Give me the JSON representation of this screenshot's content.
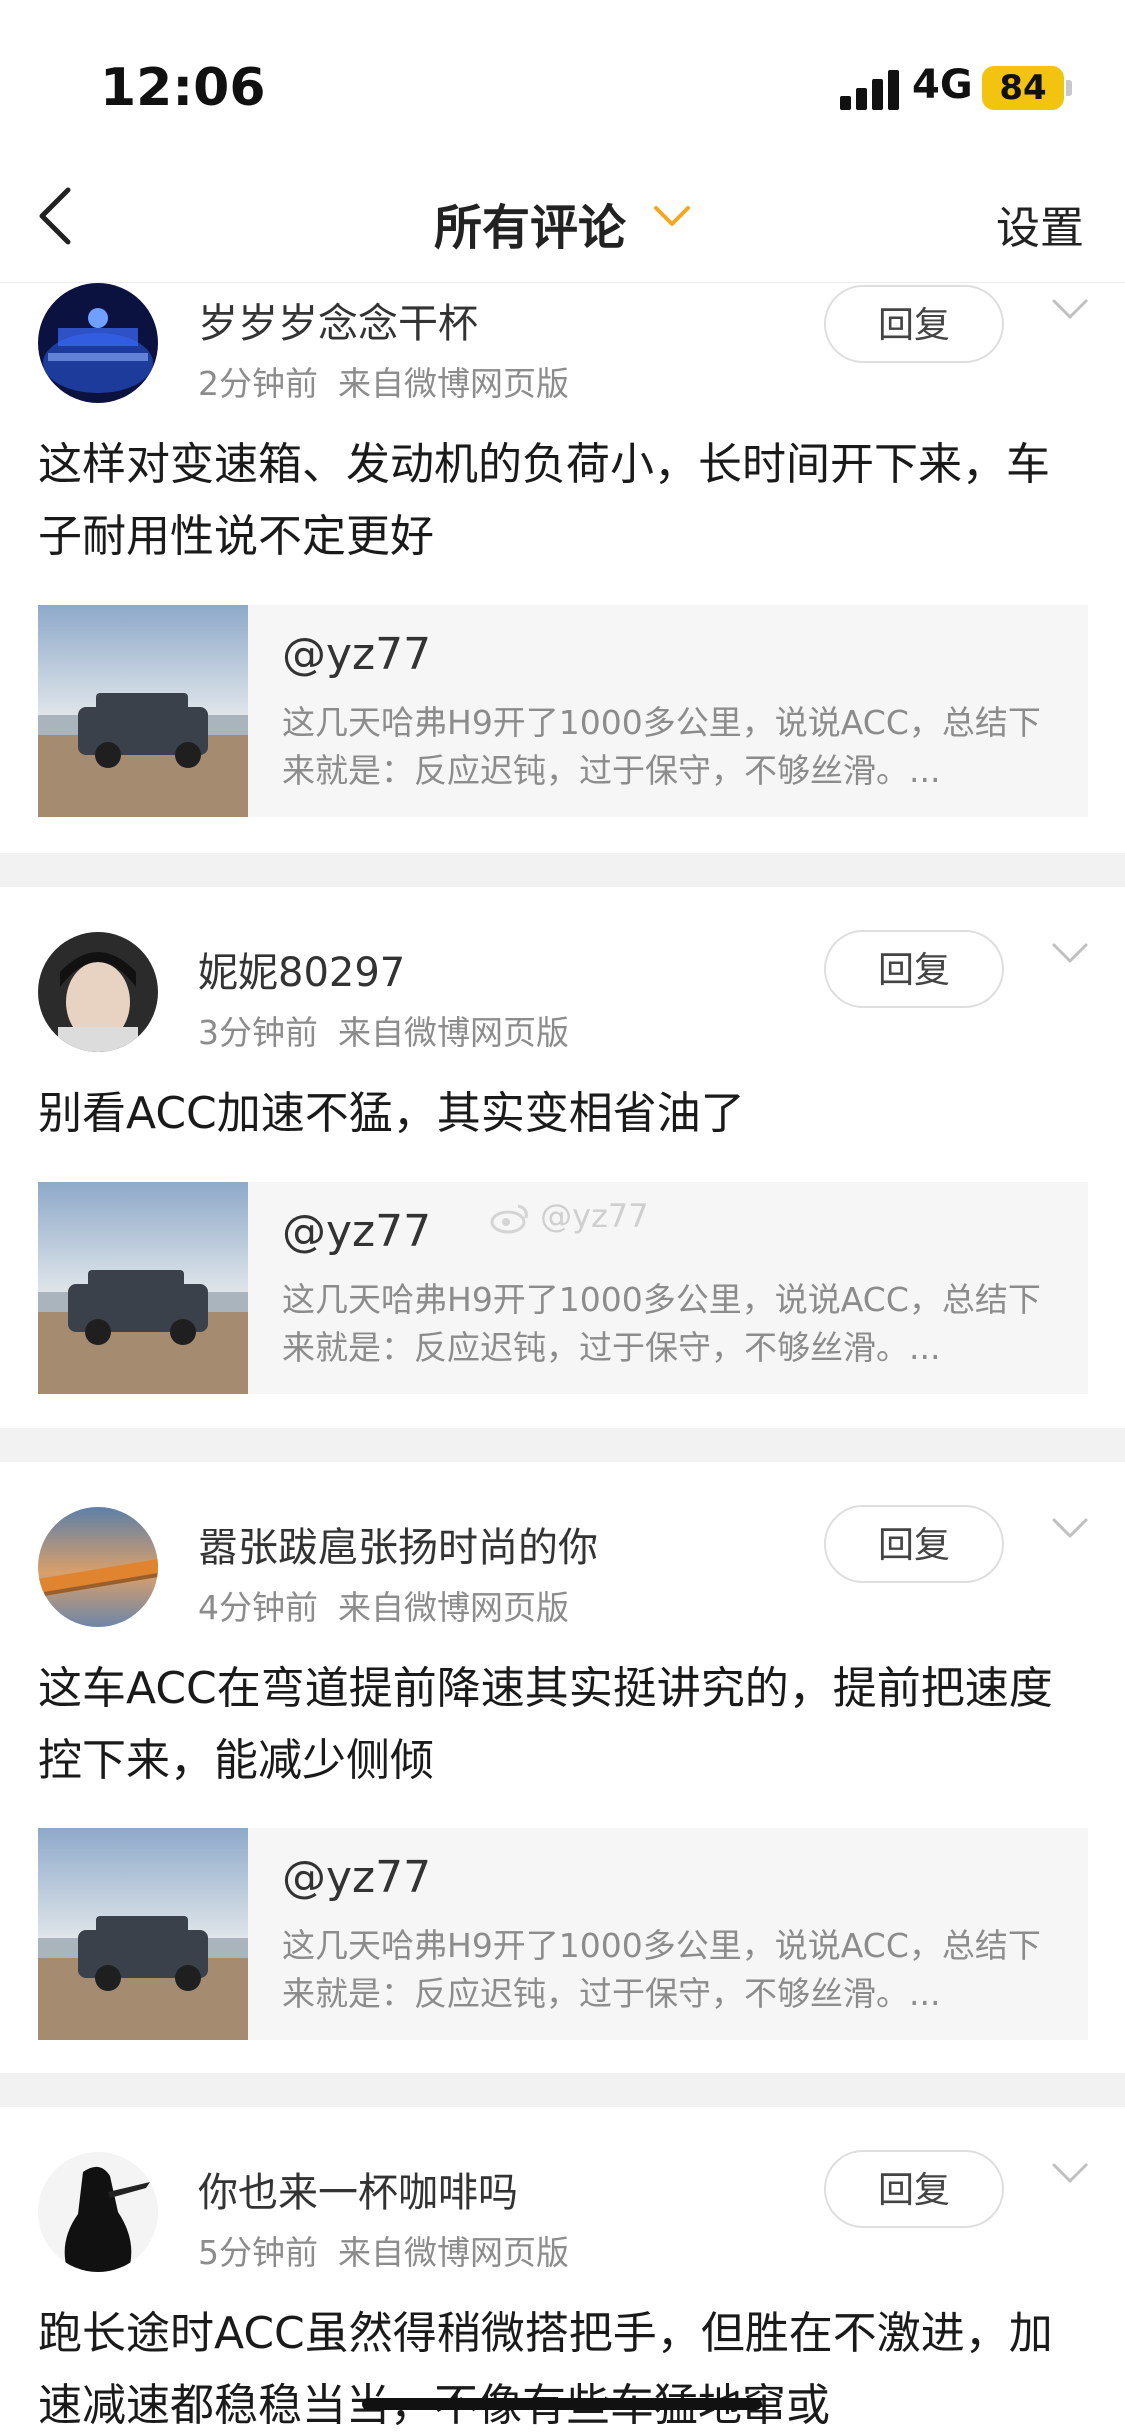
{
  "status_bar": {
    "time": "12:06",
    "network": "4G",
    "battery": "84"
  },
  "nav": {
    "title": "所有评论",
    "settings_label": "设置"
  },
  "reply_label": "回复",
  "comments": [
    {
      "user": "岁岁岁念念干杯",
      "time": "2分钟前",
      "source": "来自微博网页版",
      "text": "这样对变速箱、发动机的负荷小，长时间开下来，车子耐用性说不定更好",
      "quote_user": "@yz77",
      "quote_text": "这几天哈弗H9开了1000多公里，说说ACC，总结下来就是：反应迟钝，过于保守，不够丝滑。..."
    },
    {
      "user": "妮妮80297",
      "time": "3分钟前",
      "source": "来自微博网页版",
      "text": "别看ACC加速不猛，其实变相省油了",
      "quote_user": "@yz77",
      "quote_text": "这几天哈弗H9开了1000多公里，说说ACC，总结下来就是：反应迟钝，过于保守，不够丝滑。..."
    },
    {
      "user": "嚣张跋扈张扬时尚的你",
      "time": "4分钟前",
      "source": "来自微博网页版",
      "text": "这车ACC在弯道提前降速其实挺讲究的，提前把速度控下来，能减少侧倾",
      "quote_user": "@yz77",
      "quote_text": "这几天哈弗H9开了1000多公里，说说ACC，总结下来就是：反应迟钝，过于保守，不够丝滑。..."
    },
    {
      "user": "你也来一杯咖啡吗",
      "time": "5分钟前",
      "source": "来自微博网页版",
      "text": "跑长途时ACC虽然得稍微搭把手，但胜在不激进，加速减速都稳稳当当，不像有些车猛地窜或"
    }
  ],
  "watermark": "@yz77",
  "colors": {
    "accent": "#f5a623",
    "separator": "#f2f2f2",
    "battery": "#f2c40f"
  }
}
